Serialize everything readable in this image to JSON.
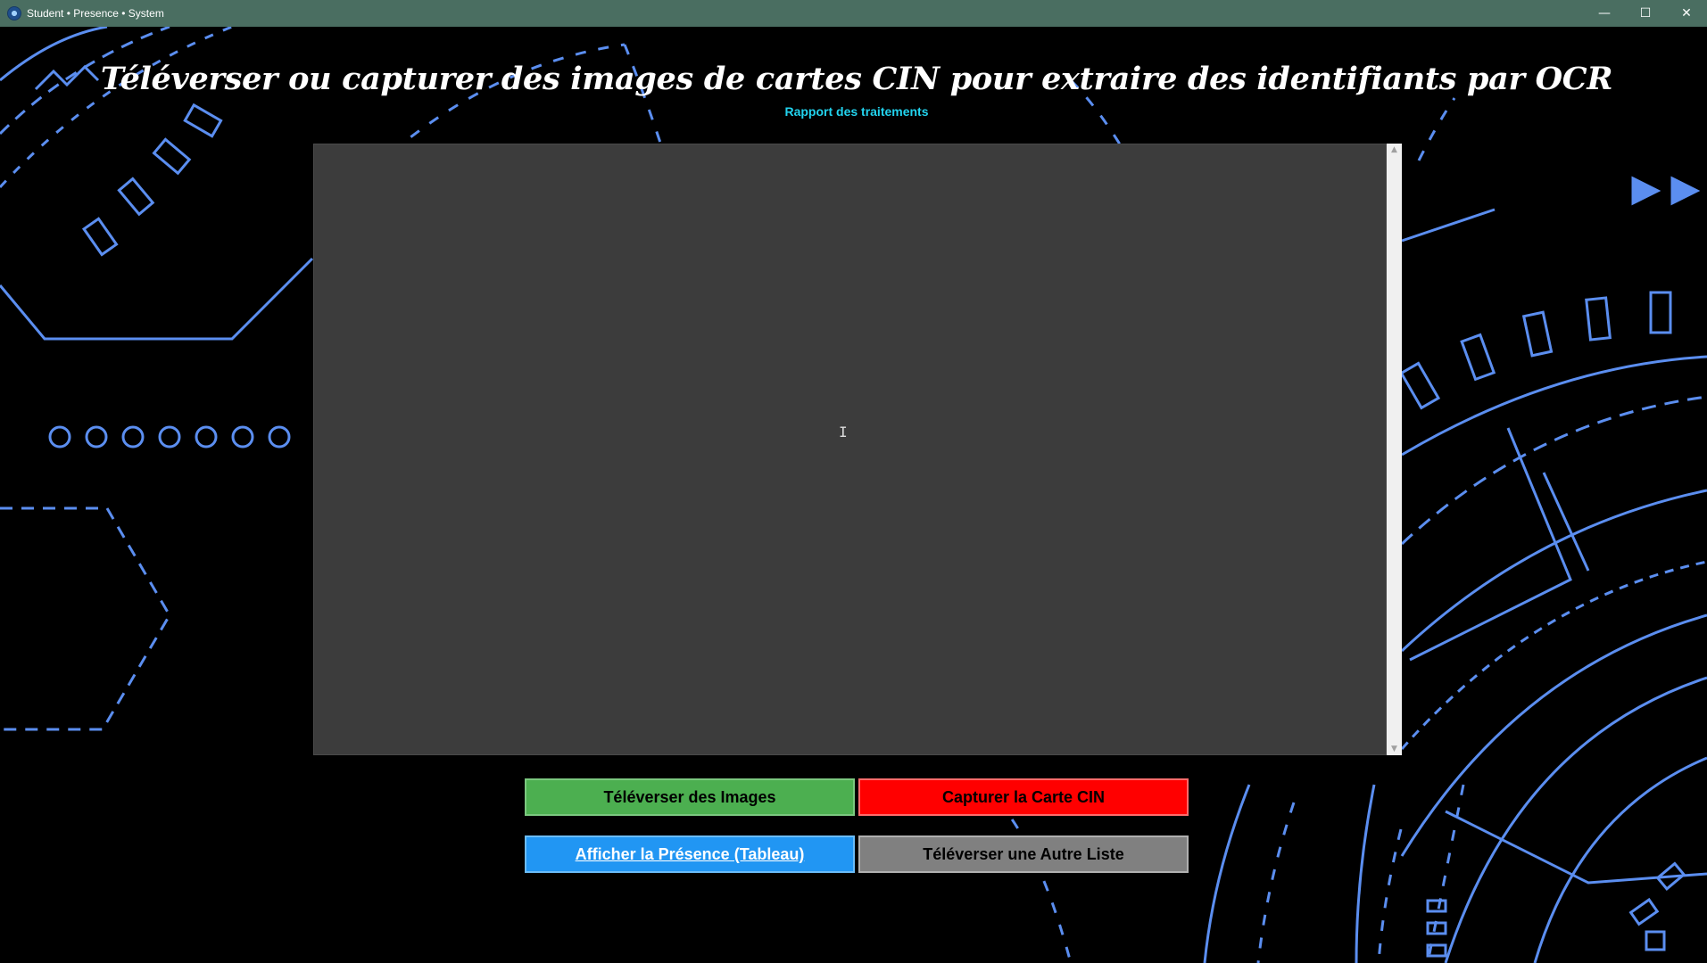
{
  "window": {
    "title": "Student • Presence • System",
    "minimize_glyph": "—",
    "maximize_glyph": "☐",
    "close_glyph": "✕"
  },
  "heading": "Téléverser ou capturer des images de cartes CIN pour extraire des identifiants par OCR",
  "report": {
    "label": "Rapport des traitements",
    "content": ""
  },
  "buttons": {
    "upload_images": "Téléverser des Images",
    "capture_card": "Capturer la Carte CIN",
    "show_presence": "Afficher la Présence (Tableau)",
    "upload_other_list": "Téléverser une Autre Liste"
  },
  "colors": {
    "titlebar": "#4a6e61",
    "accent_line": "#5b8ef0",
    "report_label": "#22d3ee",
    "upload_button": "#4caf50",
    "capture_button": "#ff0000",
    "show_button": "#2196f3",
    "other_button": "#808080"
  }
}
